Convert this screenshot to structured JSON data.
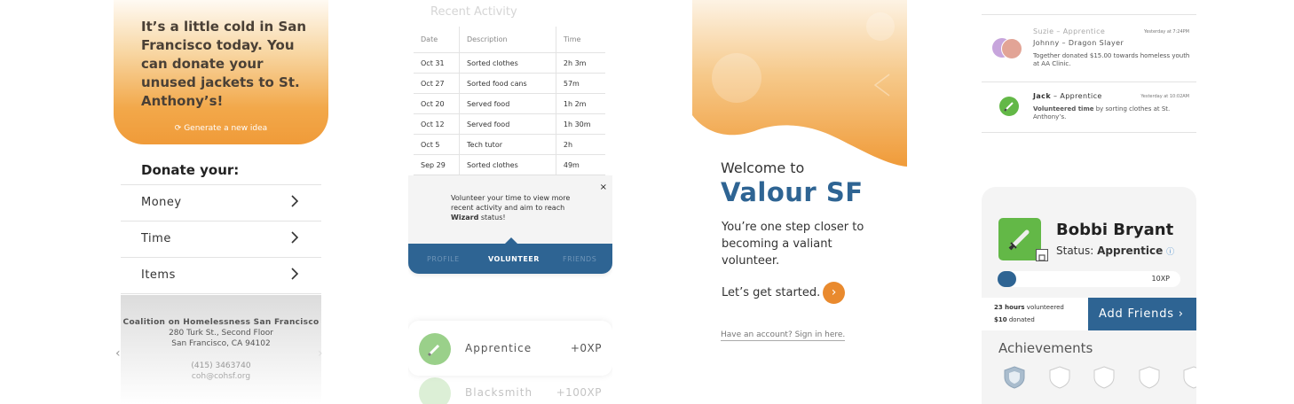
{
  "panel1": {
    "hero_text": "It’s a little cold in San Francisco today. You can donate your unused jackets to St. Anthony’s!",
    "generate_idea": "⟳ Generate a new idea",
    "donate_title": "Donate your:",
    "options": [
      {
        "label": "Money"
      },
      {
        "label": "Time"
      },
      {
        "label": "Items"
      }
    ],
    "org": {
      "name": "Coalition on Homelessness San Francisco",
      "address1": "280 Turk St., Second Floor",
      "address2": "San Francisco, CA 94102",
      "phone": "(415) 3463740",
      "email": "coh@cohsf.org"
    },
    "prev_arrow": "‹",
    "next_arrow": "›"
  },
  "panel2": {
    "title": "Recent Activity",
    "columns": [
      "Date",
      "Description",
      "Time"
    ],
    "rows": [
      {
        "date": "Oct 31",
        "desc": "Sorted clothes",
        "time": "2h 3m"
      },
      {
        "date": "Oct 27",
        "desc": "Sorted food cans",
        "time": "57m"
      },
      {
        "date": "Oct 20",
        "desc": "Served food",
        "time": "1h 2m"
      },
      {
        "date": "Oct 12",
        "desc": "Served food",
        "time": "1h 30m"
      },
      {
        "date": "Oct 5",
        "desc": "Tech tutor",
        "time": "2h"
      },
      {
        "date": "Sep 29",
        "desc": "Sorted clothes",
        "time": "49m"
      }
    ],
    "popup": {
      "text_before": "Volunteer your time to view more recent activity and aim to reach ",
      "bold": "Wizard",
      "text_after": " status!",
      "close": "×"
    },
    "tabs": [
      "PROFILE",
      "VOLUNTEER",
      "FRIENDS"
    ],
    "ranks": [
      {
        "name": "Apprentice",
        "xp": "+0XP"
      },
      {
        "name": "Blacksmith",
        "xp": "+100XP"
      }
    ]
  },
  "panel3": {
    "welcome": "Welcome to",
    "brand": "Valour SF",
    "subtitle": "You’re one step closer to becoming a valiant volunteer.",
    "start": "Let’s get started.",
    "go": "›",
    "signin": "Have an account? Sign in here."
  },
  "panel4": {
    "feed": [
      {
        "names": [
          "Suzie – Apprentice",
          "Johnny – Dragon Slayer"
        ],
        "time": "Yesterday at 7:24PM",
        "desc": "Together donated $15.00 towards homeless youth at AA Clinic."
      },
      {
        "name_bold": "Jack",
        "name_rest": " – Apprentice",
        "time": "Yesterday at 10:02AM",
        "desc_bold": "Volunteered time",
        "desc_rest": " by sorting clothes at St. Anthony’s."
      }
    ],
    "profile": {
      "name": "Bobbi Bryant",
      "status_label": "Status: ",
      "status_value": "Apprentice",
      "info_icon": "ⓘ",
      "xp": "10XP",
      "progress": 0.1,
      "hours_value": "23 hours",
      "hours_label": " volunteered",
      "donated_value": "$10",
      "donated_label": " donated",
      "add_friends": "Add Friends ›"
    },
    "achievements_title": "Achievements"
  },
  "colors": {
    "orange": "#f09b39",
    "navy": "#2e6493",
    "green": "#63b847"
  }
}
